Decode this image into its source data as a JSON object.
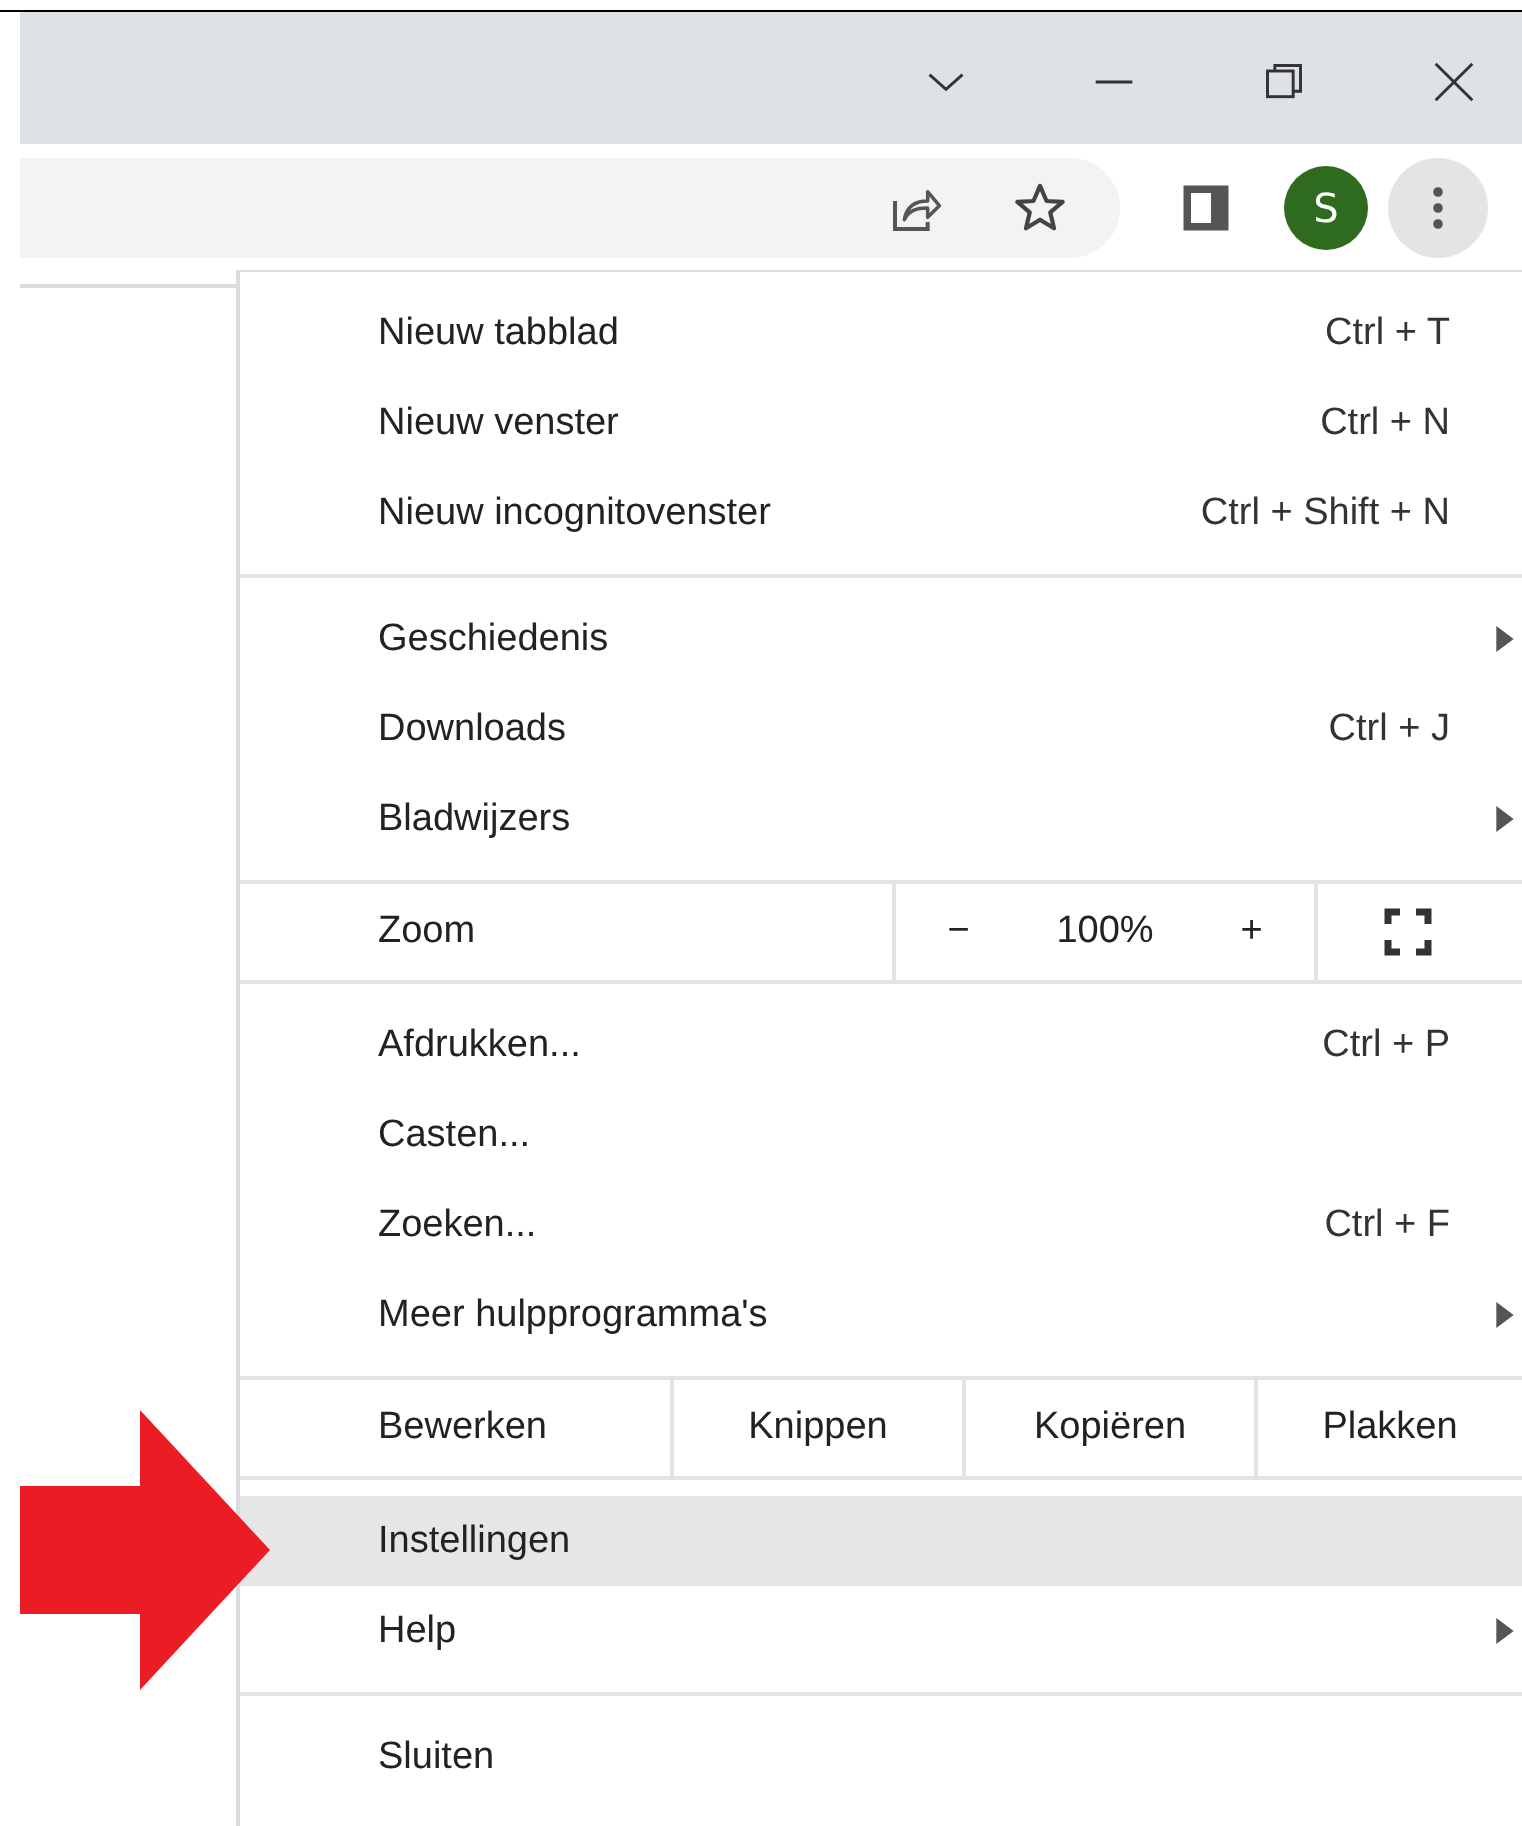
{
  "toolbar": {
    "avatar": {
      "initial": "S",
      "color": "#2e6b1f"
    }
  },
  "menu": {
    "groups": [
      {
        "items": [
          {
            "kind": "command",
            "label": "Nieuw tabblad",
            "shortcut": "Ctrl + T",
            "submenu": false,
            "highlighted": false
          },
          {
            "kind": "command",
            "label": "Nieuw venster",
            "shortcut": "Ctrl + N",
            "submenu": false,
            "highlighted": false
          },
          {
            "kind": "command",
            "label": "Nieuw incognitovenster",
            "shortcut": "Ctrl + Shift + N",
            "submenu": false,
            "highlighted": false
          }
        ]
      },
      {
        "items": [
          {
            "kind": "command",
            "label": "Geschiedenis",
            "submenu": true,
            "highlighted": false
          },
          {
            "kind": "command",
            "label": "Downloads",
            "shortcut": "Ctrl + J",
            "submenu": false,
            "highlighted": false
          },
          {
            "kind": "command",
            "label": "Bladwijzers",
            "submenu": true,
            "highlighted": false
          }
        ]
      },
      {
        "items": [
          {
            "kind": "zoom",
            "label": "Zoom",
            "minus": "−",
            "value": "100%",
            "plus": "+"
          }
        ]
      },
      {
        "items": [
          {
            "kind": "command",
            "label": "Afdrukken...",
            "shortcut": "Ctrl + P",
            "submenu": false,
            "highlighted": false
          },
          {
            "kind": "command",
            "label": "Casten...",
            "submenu": false,
            "highlighted": false
          },
          {
            "kind": "command",
            "label": "Zoeken...",
            "shortcut": "Ctrl + F",
            "submenu": false,
            "highlighted": false
          },
          {
            "kind": "command",
            "label": "Meer hulpprogramma's",
            "submenu": true,
            "highlighted": false
          }
        ]
      },
      {
        "items": [
          {
            "kind": "edit",
            "label": "Bewerken",
            "buttons": [
              "Knippen",
              "Kopiëren",
              "Plakken"
            ]
          }
        ]
      },
      {
        "items": [
          {
            "kind": "command",
            "label": "Instellingen",
            "submenu": false,
            "highlighted": true
          },
          {
            "kind": "command",
            "label": "Help",
            "submenu": true,
            "highlighted": false
          }
        ]
      },
      {
        "items": [
          {
            "kind": "command",
            "label": "Sluiten",
            "submenu": false,
            "highlighted": false
          }
        ]
      }
    ]
  }
}
